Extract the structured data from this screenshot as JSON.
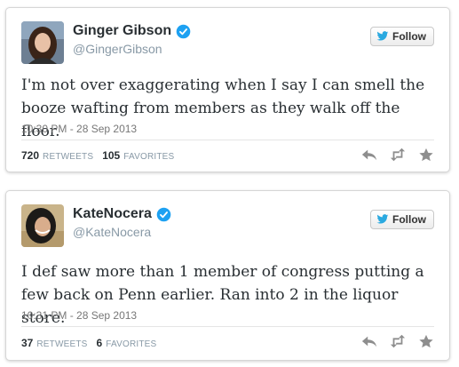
{
  "tweets": [
    {
      "display_name": "Ginger Gibson",
      "handle": "@GingerGibson",
      "follow_label": "Follow",
      "text": "I'm not over exaggerating when I say I can smell the booze wafting from members as they walk off the floor.",
      "timestamp": "10:30 PM - 28 Sep 2013",
      "retweets": "720",
      "retweets_label": "RETWEETS",
      "favorites": "105",
      "favorites_label": "FAVORITES"
    },
    {
      "display_name": "KateNocera",
      "handle": "@KateNocera",
      "follow_label": "Follow",
      "text": "I def saw more than 1 member of congress putting a few back on Penn earlier. Ran into 2 in the liquor store.",
      "timestamp": "10:31 PM - 28 Sep 2013",
      "retweets": "37",
      "retweets_label": "RETWEETS",
      "favorites": "6",
      "favorites_label": "FAVORITES"
    }
  ],
  "colors": {
    "verified": "#1da1f2",
    "twitter_bird": "#2aa9e0",
    "action_icon": "#8e8e8e"
  },
  "icons": {
    "verified": "verified-badge-icon",
    "follow": "twitter-bird-icon",
    "reply": "reply-icon",
    "retweet": "retweet-icon",
    "favorite": "star-icon"
  }
}
